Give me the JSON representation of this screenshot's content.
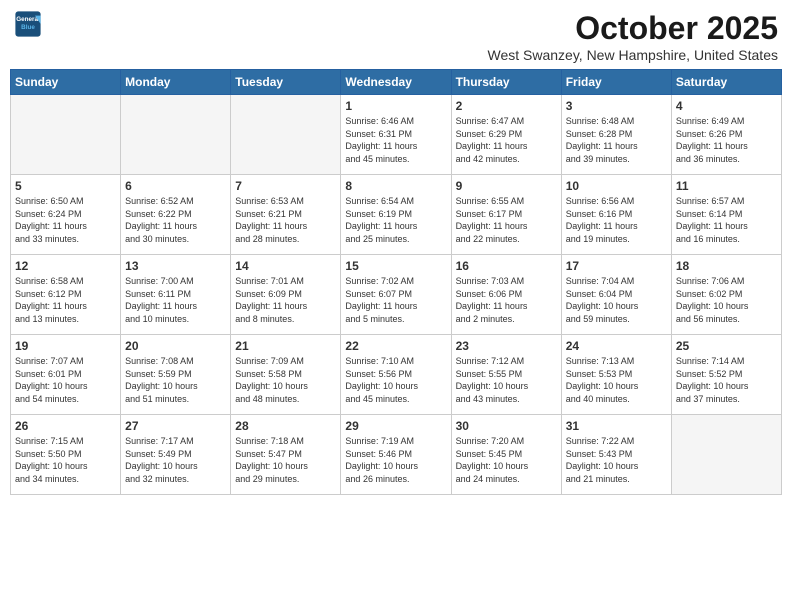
{
  "logo": {
    "line1": "General",
    "line2": "Blue"
  },
  "title": "October 2025",
  "subtitle": "West Swanzey, New Hampshire, United States",
  "days_of_week": [
    "Sunday",
    "Monday",
    "Tuesday",
    "Wednesday",
    "Thursday",
    "Friday",
    "Saturday"
  ],
  "weeks": [
    [
      {
        "day": "",
        "info": ""
      },
      {
        "day": "",
        "info": ""
      },
      {
        "day": "",
        "info": ""
      },
      {
        "day": "1",
        "info": "Sunrise: 6:46 AM\nSunset: 6:31 PM\nDaylight: 11 hours\nand 45 minutes."
      },
      {
        "day": "2",
        "info": "Sunrise: 6:47 AM\nSunset: 6:29 PM\nDaylight: 11 hours\nand 42 minutes."
      },
      {
        "day": "3",
        "info": "Sunrise: 6:48 AM\nSunset: 6:28 PM\nDaylight: 11 hours\nand 39 minutes."
      },
      {
        "day": "4",
        "info": "Sunrise: 6:49 AM\nSunset: 6:26 PM\nDaylight: 11 hours\nand 36 minutes."
      }
    ],
    [
      {
        "day": "5",
        "info": "Sunrise: 6:50 AM\nSunset: 6:24 PM\nDaylight: 11 hours\nand 33 minutes."
      },
      {
        "day": "6",
        "info": "Sunrise: 6:52 AM\nSunset: 6:22 PM\nDaylight: 11 hours\nand 30 minutes."
      },
      {
        "day": "7",
        "info": "Sunrise: 6:53 AM\nSunset: 6:21 PM\nDaylight: 11 hours\nand 28 minutes."
      },
      {
        "day": "8",
        "info": "Sunrise: 6:54 AM\nSunset: 6:19 PM\nDaylight: 11 hours\nand 25 minutes."
      },
      {
        "day": "9",
        "info": "Sunrise: 6:55 AM\nSunset: 6:17 PM\nDaylight: 11 hours\nand 22 minutes."
      },
      {
        "day": "10",
        "info": "Sunrise: 6:56 AM\nSunset: 6:16 PM\nDaylight: 11 hours\nand 19 minutes."
      },
      {
        "day": "11",
        "info": "Sunrise: 6:57 AM\nSunset: 6:14 PM\nDaylight: 11 hours\nand 16 minutes."
      }
    ],
    [
      {
        "day": "12",
        "info": "Sunrise: 6:58 AM\nSunset: 6:12 PM\nDaylight: 11 hours\nand 13 minutes."
      },
      {
        "day": "13",
        "info": "Sunrise: 7:00 AM\nSunset: 6:11 PM\nDaylight: 11 hours\nand 10 minutes."
      },
      {
        "day": "14",
        "info": "Sunrise: 7:01 AM\nSunset: 6:09 PM\nDaylight: 11 hours\nand 8 minutes."
      },
      {
        "day": "15",
        "info": "Sunrise: 7:02 AM\nSunset: 6:07 PM\nDaylight: 11 hours\nand 5 minutes."
      },
      {
        "day": "16",
        "info": "Sunrise: 7:03 AM\nSunset: 6:06 PM\nDaylight: 11 hours\nand 2 minutes."
      },
      {
        "day": "17",
        "info": "Sunrise: 7:04 AM\nSunset: 6:04 PM\nDaylight: 10 hours\nand 59 minutes."
      },
      {
        "day": "18",
        "info": "Sunrise: 7:06 AM\nSunset: 6:02 PM\nDaylight: 10 hours\nand 56 minutes."
      }
    ],
    [
      {
        "day": "19",
        "info": "Sunrise: 7:07 AM\nSunset: 6:01 PM\nDaylight: 10 hours\nand 54 minutes."
      },
      {
        "day": "20",
        "info": "Sunrise: 7:08 AM\nSunset: 5:59 PM\nDaylight: 10 hours\nand 51 minutes."
      },
      {
        "day": "21",
        "info": "Sunrise: 7:09 AM\nSunset: 5:58 PM\nDaylight: 10 hours\nand 48 minutes."
      },
      {
        "day": "22",
        "info": "Sunrise: 7:10 AM\nSunset: 5:56 PM\nDaylight: 10 hours\nand 45 minutes."
      },
      {
        "day": "23",
        "info": "Sunrise: 7:12 AM\nSunset: 5:55 PM\nDaylight: 10 hours\nand 43 minutes."
      },
      {
        "day": "24",
        "info": "Sunrise: 7:13 AM\nSunset: 5:53 PM\nDaylight: 10 hours\nand 40 minutes."
      },
      {
        "day": "25",
        "info": "Sunrise: 7:14 AM\nSunset: 5:52 PM\nDaylight: 10 hours\nand 37 minutes."
      }
    ],
    [
      {
        "day": "26",
        "info": "Sunrise: 7:15 AM\nSunset: 5:50 PM\nDaylight: 10 hours\nand 34 minutes."
      },
      {
        "day": "27",
        "info": "Sunrise: 7:17 AM\nSunset: 5:49 PM\nDaylight: 10 hours\nand 32 minutes."
      },
      {
        "day": "28",
        "info": "Sunrise: 7:18 AM\nSunset: 5:47 PM\nDaylight: 10 hours\nand 29 minutes."
      },
      {
        "day": "29",
        "info": "Sunrise: 7:19 AM\nSunset: 5:46 PM\nDaylight: 10 hours\nand 26 minutes."
      },
      {
        "day": "30",
        "info": "Sunrise: 7:20 AM\nSunset: 5:45 PM\nDaylight: 10 hours\nand 24 minutes."
      },
      {
        "day": "31",
        "info": "Sunrise: 7:22 AM\nSunset: 5:43 PM\nDaylight: 10 hours\nand 21 minutes."
      },
      {
        "day": "",
        "info": ""
      }
    ]
  ]
}
